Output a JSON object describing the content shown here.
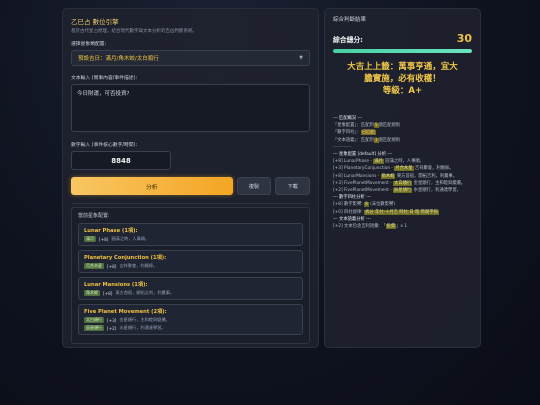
{
  "left": {
    "title": "乙巳占 數位引擎",
    "subtitle": "基於古代星占原理，結合現代數字與文本分析的吉凶判斷系統。",
    "select_label": "選擇星象類配置:",
    "select_value": "預設吉日：滿月/角木蛟/太白順行",
    "text_label": "文本輸入 (問事內容/事件描述):",
    "text_value": "今日財運，可否投資?",
    "number_label": "數字輸入 (事件核心數字/時間):",
    "number_value": "8848",
    "analyze_button": "分析",
    "copy_button": "複製",
    "download_button": "下載",
    "rules_title": "當前星象配置:",
    "rules": [
      {
        "name": "Lunar Phase (1項):",
        "tag": "滿月",
        "weight": "[+8]",
        "desc": "圓滿之時，人事順。"
      },
      {
        "name": "Planetary Conjunction (1項):",
        "tag": "月合木星",
        "weight": "[+8]",
        "desc": "吉祥聚會，利婚嫁。"
      },
      {
        "name": "Lunar Mansions (1項):",
        "tag": "角木蛟",
        "weight": "[+8]",
        "desc": "東方首宿，開拓吉利，利農事。"
      },
      {
        "name": "Five Planet Movement (2項):",
        "tag": "太白順行",
        "weight": "[+3]",
        "desc": "金星順行，主和睦與變遷。",
        "tag2": "辰星順行",
        "weight2": "[+2]",
        "desc2": "水星順行，利通達學習。"
      }
    ]
  },
  "right": {
    "title": "綜合判斷結果",
    "score_label": "綜合總分:",
    "score": "30",
    "score_fraction": 1.0,
    "verdict_line1": "大吉上上籤：萬事亨通，宜大",
    "verdict_line2": "膽實施，必有收穫！",
    "verdict_line3": "等級：A+",
    "analysis": {
      "h1": "--- 匹配概況 ---",
      "l1a": "「星象配置」：匹配到",
      "l1n": "5",
      "l1b": "個匹配規則",
      "l2a": "「數字四柱」：",
      "l2h": "已匹配",
      "l3a": "「文本語義」：匹配到",
      "l3n": "1",
      "l3b": "個匹配規則",
      "rule": "------------",
      "h2": "--- 星象配置 [default] 分析 ---",
      "s1a": "[+8] LunarPhase - ",
      "s1h": "滿月",
      "s1b": " 圓滿之時，人事順。",
      "s2a": "[+3] PlanetaryConjunction - ",
      "s2h": "月合木星",
      "s2b": " 吉祥聚會，利婚嫁。",
      "s3a": "[+8] LunarMansions - ",
      "s3h": "角木蛟",
      "s3b": " 東方首宿，開拓吉利，利農事。",
      "s4a": "[+3] FivePlanetMovement - ",
      "s4h": "太白順行",
      "s4b": " 金星順行，主和睦與變遷。",
      "s5a": "[+2] FivePlanetMovement - ",
      "s5h": "辰星順行",
      "s5b": " 水星順行，利通達學習。",
      "h3": "--- 數字四柱分析 ---",
      "n1a": "[+8] 數字影響: ",
      "n1h": "8",
      "n1b": " (末位數影響)",
      "n2a": "[+0] 四柱規律: ",
      "n2h": "拆分 年柱:十月吉 時柱:日 暗 時間平和",
      "h4": "--- 文本語義分析 ---",
      "t1a": "[+2] 文本包含吉利詞彙: 「",
      "t1h": "投資",
      "t1b": "」x 1"
    }
  }
}
